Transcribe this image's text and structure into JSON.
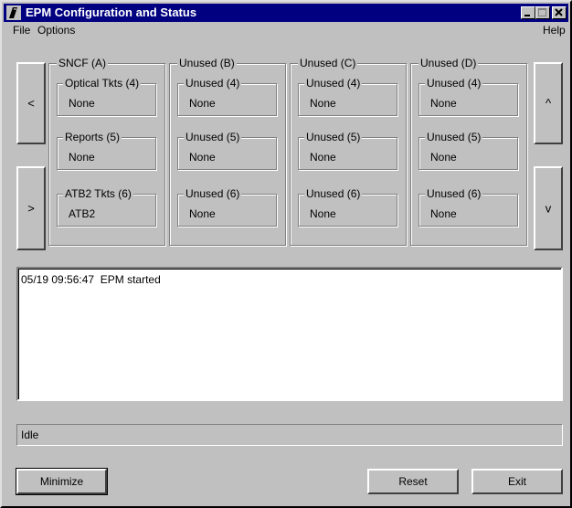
{
  "window": {
    "title": "EPM Configuration and Status"
  },
  "menu": {
    "file": "File",
    "options": "Options",
    "help": "Help"
  },
  "nav": {
    "left_up": "<",
    "left_down": ">",
    "right_up": "^",
    "right_down": "v"
  },
  "groups": [
    {
      "label": "SNCF (A)",
      "slots": [
        {
          "label": "Optical Tkts (4)",
          "value": "None"
        },
        {
          "label": "Reports (5)",
          "value": "None"
        },
        {
          "label": "ATB2 Tkts (6)",
          "value": "ATB2"
        }
      ]
    },
    {
      "label": "Unused (B)",
      "slots": [
        {
          "label": "Unused (4)",
          "value": "None"
        },
        {
          "label": "Unused (5)",
          "value": "None"
        },
        {
          "label": "Unused (6)",
          "value": "None"
        }
      ]
    },
    {
      "label": "Unused (C)",
      "slots": [
        {
          "label": "Unused (4)",
          "value": "None"
        },
        {
          "label": "Unused (5)",
          "value": "None"
        },
        {
          "label": "Unused (6)",
          "value": "None"
        }
      ]
    },
    {
      "label": "Unused (D)",
      "slots": [
        {
          "label": "Unused (4)",
          "value": "None"
        },
        {
          "label": "Unused (5)",
          "value": "None"
        },
        {
          "label": "Unused (6)",
          "value": "None"
        }
      ]
    }
  ],
  "log": {
    "lines": [
      "05/19 09:56:47  EPM started"
    ]
  },
  "status": {
    "text": "Idle"
  },
  "buttons": {
    "minimize": "Minimize",
    "reset": "Reset",
    "exit": "Exit"
  }
}
